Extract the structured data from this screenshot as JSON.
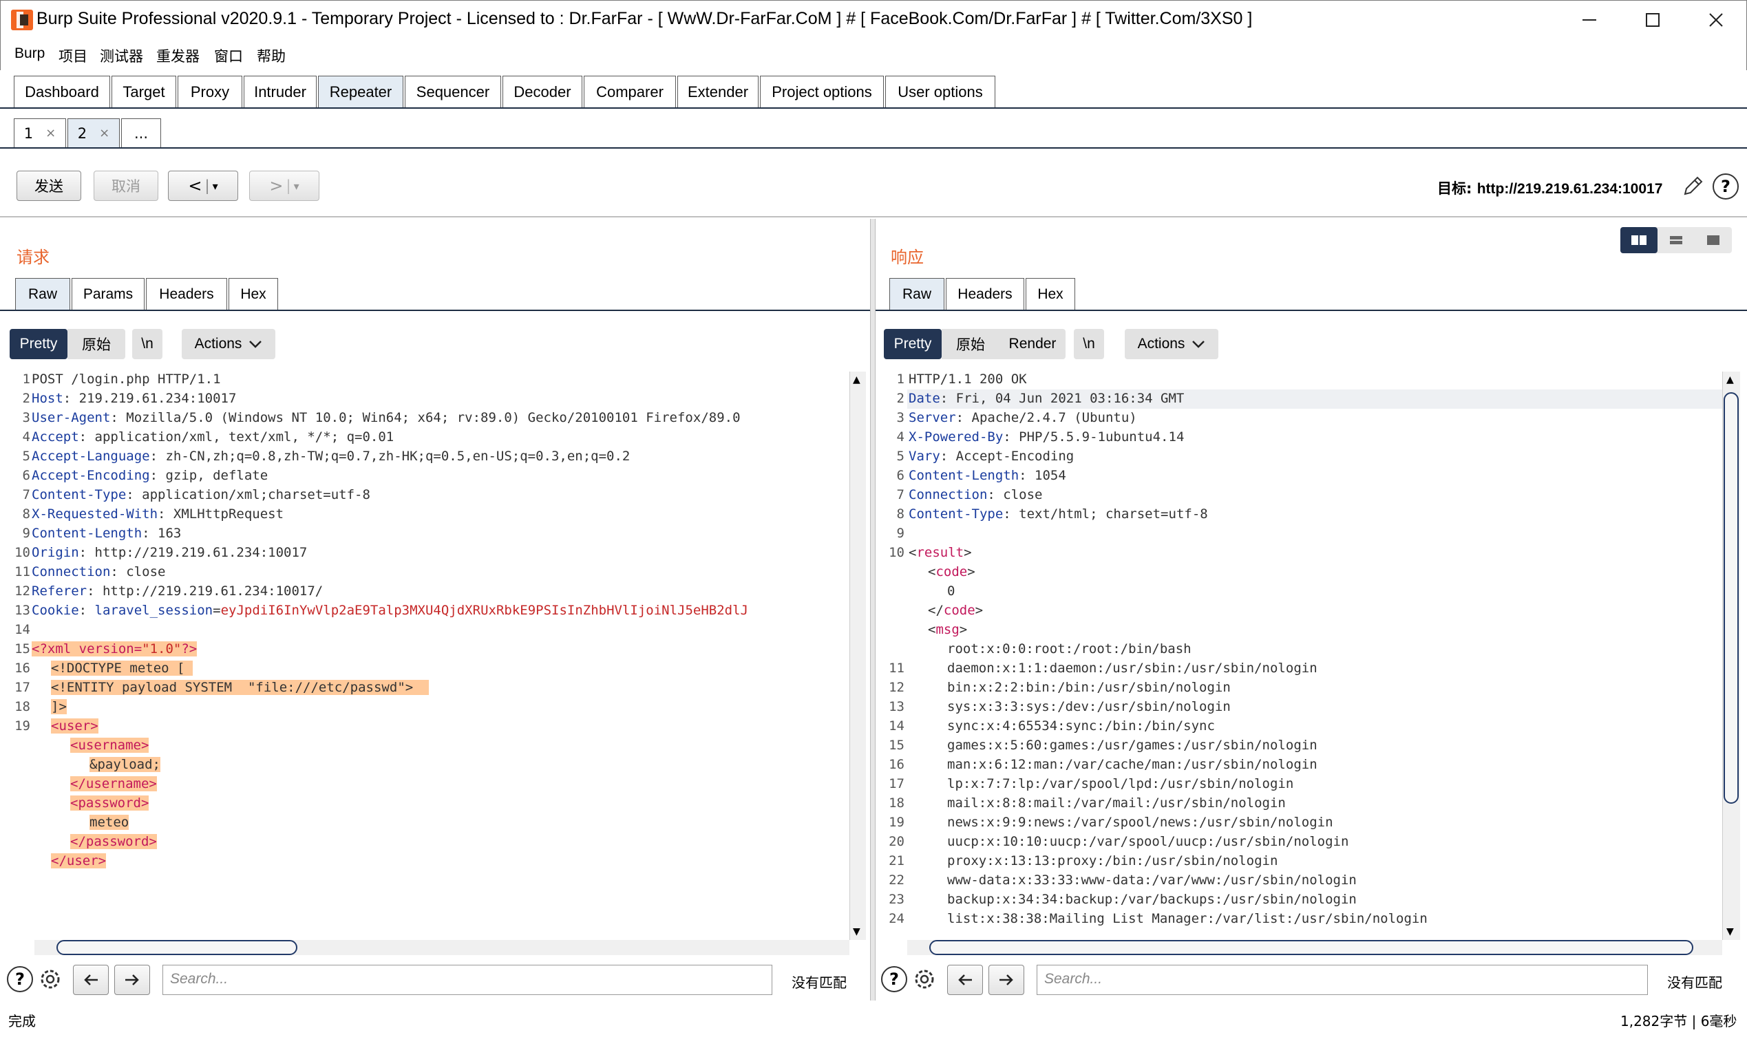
{
  "window": {
    "title": "Burp Suite Professional v2020.9.1 - Temporary Project - Licensed to : Dr.FarFar - [ WwW.Dr-FarFar.CoM ] # [ FaceBook.Com/Dr.FarFar ] # [ Twitter.Com/3XS0 ]",
    "minimize": "—",
    "maximize": "☐",
    "close": "✕"
  },
  "menu": [
    "Burp",
    "项目",
    "测试器",
    "重发器",
    "窗口",
    "帮助"
  ],
  "tabs": [
    "Dashboard",
    "Target",
    "Proxy",
    "Intruder",
    "Repeater",
    "Sequencer",
    "Decoder",
    "Comparer",
    "Extender",
    "Project options",
    "User options"
  ],
  "active_tab": "Repeater",
  "repeater_tabs": [
    {
      "label": "1",
      "close": "×"
    },
    {
      "label": "2",
      "close": "×"
    },
    {
      "label": "..."
    }
  ],
  "toolbar": {
    "send": "发送",
    "cancel": "取消",
    "back": "<",
    "forward": ">",
    "dropdown": "▾",
    "target_label": "目标:",
    "target_url": "http://219.219.61.234:10017"
  },
  "request": {
    "title": "请求",
    "tabs": [
      "Raw",
      "Params",
      "Headers",
      "Hex"
    ],
    "pills": [
      "Pretty",
      "原始",
      "\\n",
      "Actions"
    ],
    "search_placeholder": "Search...",
    "no_match": "没有匹配"
  },
  "response": {
    "title": "响应",
    "tabs": [
      "Raw",
      "Headers",
      "Hex"
    ],
    "pills": [
      "Pretty",
      "原始",
      "Render",
      "\\n",
      "Actions"
    ],
    "search_placeholder": "Search...",
    "no_match": "没有匹配"
  },
  "status": {
    "left": "完成",
    "right": "1,282字节 | 6毫秒"
  },
  "colors": {
    "accent": "#233553",
    "title_orange": "#e8642c",
    "highlight": "#ffc99a",
    "header_key": "#1a3c9e",
    "tag": "#c2185b"
  }
}
